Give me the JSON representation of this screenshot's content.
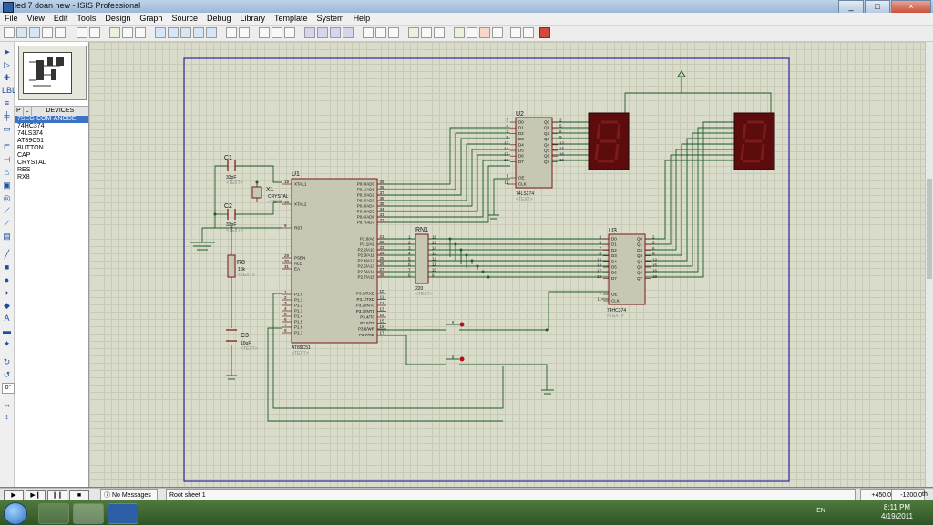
{
  "window": {
    "title": "led 7 doan new - ISIS Professional",
    "minimize": "_",
    "maximize": "□",
    "close": "×"
  },
  "menu": [
    "File",
    "View",
    "Edit",
    "Tools",
    "Design",
    "Graph",
    "Source",
    "Debug",
    "Library",
    "Template",
    "System",
    "Help"
  ],
  "panel": {
    "tab_p": "P",
    "tab_l": "L",
    "header": "DEVICES",
    "devices": [
      "7SEG-COM-ANODE",
      "74HC374",
      "74LS374",
      "AT89C51",
      "BUTTON",
      "CAP",
      "CRYSTAL",
      "RES",
      "RX8"
    ],
    "selected_index": 0
  },
  "schematic": {
    "c1": {
      "ref": "C1",
      "value": "33pF",
      "text": "<TEXT>"
    },
    "c2": {
      "ref": "C2",
      "value": "33pF",
      "text": "<TEXT>"
    },
    "x1": {
      "ref": "X1",
      "value": "CRYSTAL",
      "text": "<TEXT>"
    },
    "r8": {
      "ref": "R8",
      "value": "10k",
      "text": "<TEXT>"
    },
    "c3": {
      "ref": "C3",
      "value": "10uF",
      "text": "<TEXT>"
    },
    "u1": {
      "ref": "U1",
      "part": "AT89C51",
      "text": "<TEXT>",
      "left_pins": [
        {
          "num": "19",
          "name": "XTAL1"
        },
        {
          "num": "18",
          "name": "XTAL2"
        },
        {
          "num": "9",
          "name": "RST"
        },
        {
          "num": "29",
          "name": "PSEN"
        },
        {
          "num": "30",
          "name": "ALE"
        },
        {
          "num": "31",
          "name": "EA"
        },
        {
          "num": "1",
          "name": "P1.0"
        },
        {
          "num": "2",
          "name": "P1.1"
        },
        {
          "num": "3",
          "name": "P1.2"
        },
        {
          "num": "4",
          "name": "P1.3"
        },
        {
          "num": "5",
          "name": "P1.4"
        },
        {
          "num": "6",
          "name": "P1.5"
        },
        {
          "num": "7",
          "name": "P1.6"
        },
        {
          "num": "8",
          "name": "P1.7"
        }
      ],
      "right_pins": [
        {
          "num": "39",
          "name": "P0.0/AD0"
        },
        {
          "num": "38",
          "name": "P0.1/AD1"
        },
        {
          "num": "37",
          "name": "P0.2/AD2"
        },
        {
          "num": "36",
          "name": "P0.3/AD3"
        },
        {
          "num": "35",
          "name": "P0.4/AD4"
        },
        {
          "num": "34",
          "name": "P0.5/AD5"
        },
        {
          "num": "33",
          "name": "P0.6/AD6"
        },
        {
          "num": "32",
          "name": "P0.7/AD7"
        },
        {
          "num": "21",
          "name": "P2.0/A8"
        },
        {
          "num": "22",
          "name": "P2.1/A9"
        },
        {
          "num": "23",
          "name": "P2.2/A10"
        },
        {
          "num": "24",
          "name": "P2.3/A11"
        },
        {
          "num": "25",
          "name": "P2.4/A12"
        },
        {
          "num": "26",
          "name": "P2.5/A13"
        },
        {
          "num": "27",
          "name": "P2.6/A14"
        },
        {
          "num": "28",
          "name": "P2.7/A15"
        },
        {
          "num": "10",
          "name": "P3.0/RXD"
        },
        {
          "num": "11",
          "name": "P3.1/TXD"
        },
        {
          "num": "12",
          "name": "P3.2/INT0"
        },
        {
          "num": "13",
          "name": "P3.3/INT1"
        },
        {
          "num": "14",
          "name": "P3.4/T0"
        },
        {
          "num": "15",
          "name": "P3.5/T1"
        },
        {
          "num": "16",
          "name": "P3.6/WR"
        },
        {
          "num": "17",
          "name": "P3.7/RD"
        }
      ]
    },
    "rn1": {
      "ref": "RN1",
      "value": "220",
      "text": "<TEXT>",
      "left": [
        "1",
        "2",
        "3",
        "4",
        "5",
        "6",
        "7",
        "8"
      ],
      "right": [
        "16",
        "15",
        "14",
        "13",
        "12",
        "11",
        "10",
        "9"
      ]
    },
    "u2": {
      "ref": "U2",
      "part": "74LS374",
      "text": "<TEXT>",
      "in": [
        {
          "num": "3",
          "name": "D0"
        },
        {
          "num": "4",
          "name": "D1"
        },
        {
          "num": "7",
          "name": "D2"
        },
        {
          "num": "8",
          "name": "D3"
        },
        {
          "num": "13",
          "name": "D4"
        },
        {
          "num": "14",
          "name": "D5"
        },
        {
          "num": "17",
          "name": "D6"
        },
        {
          "num": "18",
          "name": "D7"
        }
      ],
      "out": [
        {
          "num": "2",
          "name": "Q0"
        },
        {
          "num": "5",
          "name": "Q1"
        },
        {
          "num": "6",
          "name": "Q2"
        },
        {
          "num": "9",
          "name": "Q3"
        },
        {
          "num": "12",
          "name": "Q4"
        },
        {
          "num": "15",
          "name": "Q5"
        },
        {
          "num": "16",
          "name": "Q6"
        },
        {
          "num": "19",
          "name": "Q7"
        }
      ],
      "ctrl": [
        {
          "num": "1",
          "name": "OE"
        },
        {
          "num": "11",
          "name": "CLK"
        }
      ]
    },
    "u3": {
      "ref": "U3",
      "part": "74HC374",
      "text": "<TEXT>",
      "in": [
        {
          "num": "3",
          "name": "D0"
        },
        {
          "num": "4",
          "name": "D1"
        },
        {
          "num": "7",
          "name": "D2"
        },
        {
          "num": "8",
          "name": "D3"
        },
        {
          "num": "13",
          "name": "D4"
        },
        {
          "num": "14",
          "name": "D5"
        },
        {
          "num": "17",
          "name": "D6"
        },
        {
          "num": "18",
          "name": "D7"
        }
      ],
      "out": [
        {
          "num": "2",
          "name": "Q0"
        },
        {
          "num": "5",
          "name": "Q1"
        },
        {
          "num": "6",
          "name": "Q2"
        },
        {
          "num": "9",
          "name": "Q3"
        },
        {
          "num": "12",
          "name": "Q4"
        },
        {
          "num": "15",
          "name": "Q5"
        },
        {
          "num": "16",
          "name": "Q6"
        },
        {
          "num": "19",
          "name": "Q7"
        }
      ],
      "ctrl": [
        {
          "num": "1",
          "name": "OE"
        },
        {
          "num": "11",
          "name": "CLK"
        }
      ]
    }
  },
  "status": {
    "messages": "No Messages",
    "sheet": "Root sheet 1",
    "coord_x": "+450.0",
    "coord_y": "-1200.0",
    "units": "th",
    "zoom_field": "0°"
  },
  "taskbar": {
    "lang": "EN",
    "time": "8:11 PM",
    "date": "4/19/2011"
  },
  "colors": {
    "wire": "#1f5c2a",
    "part_fill": "#c7c8b4",
    "part_border": "#7a1818",
    "display_bg": "#5c0c0c",
    "display_seg": "#7a1a1a",
    "sheet_border": "#2a2a9c"
  }
}
